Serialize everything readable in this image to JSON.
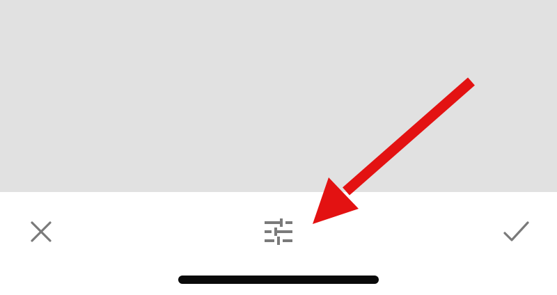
{
  "colors": {
    "preview_background": "#e1e1e1",
    "toolbar_background": "#ffffff",
    "icon_gray": "#7a7a7a",
    "home_indicator": "#0a0a0a",
    "annotation_red": "#e31212"
  },
  "toolbar": {
    "cancel_icon": "close-icon",
    "adjust_icon": "sliders-icon",
    "confirm_icon": "checkmark-icon"
  },
  "annotation": {
    "icon": "arrow-icon",
    "points_to": "adjust-button"
  }
}
